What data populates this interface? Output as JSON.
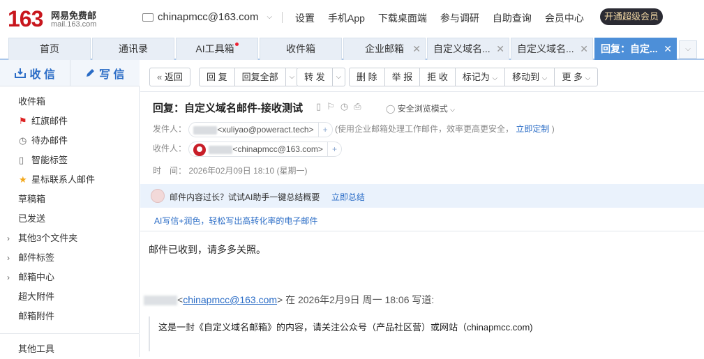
{
  "header": {
    "logo_num": "163",
    "logo_cn": "网易免费邮",
    "logo_url": "mail.163.com",
    "account": "chinapmcc@163.com",
    "links": [
      "设置",
      "手机App",
      "下载桌面端",
      "参与调研",
      "自助查询",
      "会员中心"
    ],
    "vip_button": "开通超级会员"
  },
  "tabs": [
    {
      "label": "首页"
    },
    {
      "label": "通讯录"
    },
    {
      "label": "AI工具箱"
    },
    {
      "label": "收件箱"
    },
    {
      "label": "企业邮箱"
    },
    {
      "label": "自定义域名..."
    },
    {
      "label": "自定义域名..."
    },
    {
      "label": "回复：自定..."
    }
  ],
  "sidebar": {
    "compose_receive": "收 信",
    "compose_write": "写 信",
    "items": [
      {
        "label": "收件箱"
      },
      {
        "label": "红旗邮件"
      },
      {
        "label": "待办邮件"
      },
      {
        "label": "智能标签"
      },
      {
        "label": "星标联系人邮件"
      },
      {
        "label": "草稿箱"
      },
      {
        "label": "已发送"
      },
      {
        "label": "其他3个文件夹"
      },
      {
        "label": "邮件标签"
      },
      {
        "label": "邮箱中心"
      },
      {
        "label": "超大附件"
      },
      {
        "label": "邮箱附件"
      },
      {
        "label": "其他工具"
      }
    ]
  },
  "toolbar": {
    "back": "返回",
    "reply": "回 复",
    "reply_all": "回复全部",
    "forward": "转 发",
    "delete": "删 除",
    "report": "举 报",
    "reject": "拒 收",
    "mark_as": "标记为",
    "move_to": "移动到",
    "more": "更 多"
  },
  "mail": {
    "subject": "回复：自定义域名邮件-接收测试",
    "safe_mode": "安全浏览模式",
    "from_label": "发件人：",
    "from_addr": "<xuliyao@poweract.tech>",
    "from_note": "(使用企业邮箱处理工作邮件，效率更高更安全，",
    "from_link": "立即定制",
    "from_note_end": ")",
    "to_label": "收件人：",
    "to_addr": "<chinapmcc@163.com>",
    "time_label": "时　间：",
    "time_value": "2026年02月09日 18:10 (星期一)",
    "ai_tip": "邮件内容过长？试试AI助手一键总结概要",
    "ai_link": "立即总结",
    "ai_write": "AI写信+润色，轻松写出高转化率的电子邮件",
    "body": "邮件已收到，请多多关照。",
    "quote_lt": "<",
    "quote_addr": "chinapmcc@163.com",
    "quote_tail": "> 在 2026年2月9日 周一 18:06 写道:",
    "quote_text": "这是一封《自定义域名邮箱》的内容，请关注公众号（产品社区营）或网站（chinapmcc.com)"
  }
}
